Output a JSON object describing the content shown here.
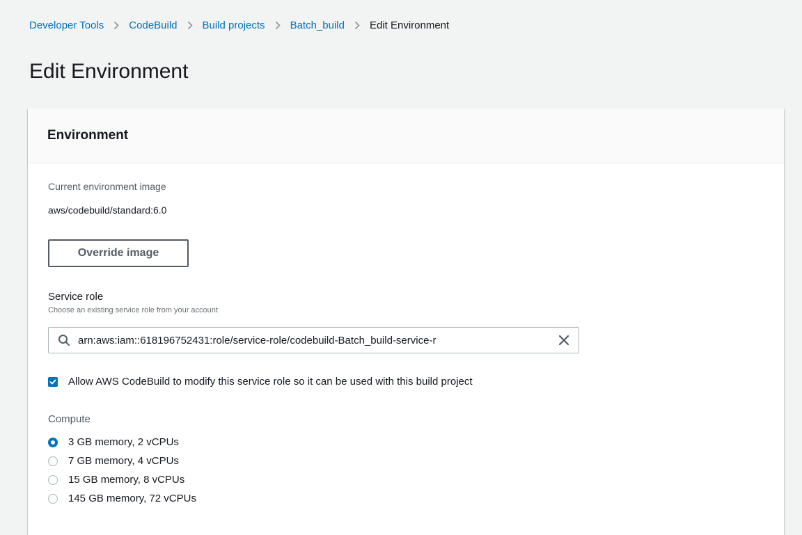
{
  "breadcrumb": {
    "items": [
      "Developer Tools",
      "CodeBuild",
      "Build projects",
      "Batch_build"
    ],
    "current": "Edit Environment"
  },
  "page_title": "Edit Environment",
  "panel": {
    "title": "Environment",
    "current_image_label": "Current environment image",
    "current_image_value": "aws/codebuild/standard:6.0",
    "override_button_label": "Override image",
    "service_role_label": "Service role",
    "service_role_description": "Choose an existing service role from your account",
    "service_role_value": "arn:aws:iam::618196752431:role/service-role/codebuild-Batch_build-service-r",
    "allow_modify_checked": true,
    "allow_modify_label": "Allow AWS CodeBuild to modify this service role so it can be used with this build project",
    "compute_label": "Compute",
    "compute_options": [
      "3 GB memory, 2 vCPUs",
      "7 GB memory, 4 vCPUs",
      "15 GB memory, 8 vCPUs",
      "145 GB memory, 72 vCPUs"
    ],
    "compute_selected_index": 0
  },
  "colors": {
    "link": "#0073bb",
    "accent": "#0073bb",
    "background": "#f2f3f3",
    "text": "#16191f"
  },
  "icons": {
    "breadcrumb_separator": "chevron-right-icon",
    "search": "search-icon",
    "clear": "close-icon",
    "checkbox": "checkmark-icon"
  }
}
